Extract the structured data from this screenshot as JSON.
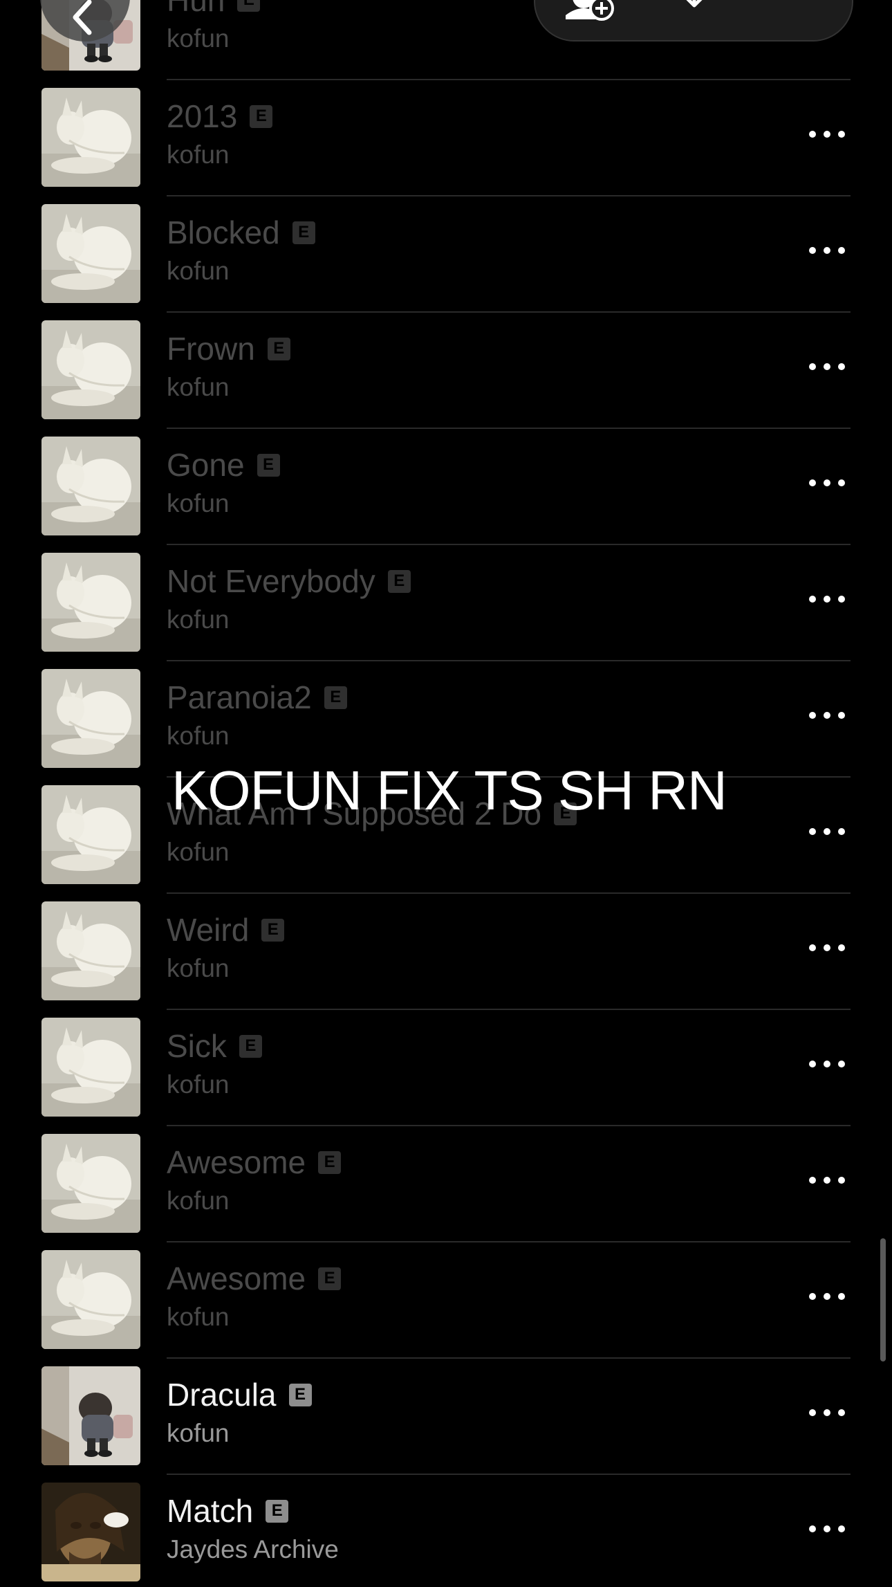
{
  "header": {
    "back_icon": "chevron-left-icon",
    "actions": [
      {
        "name": "add-user-icon"
      },
      {
        "name": "download-icon"
      }
    ]
  },
  "overlay": {
    "caption": "KOFUN FIX TS SH RN"
  },
  "tracks": [
    {
      "title": "Huh",
      "artist": "kofun",
      "explicit": "E",
      "art": "kid",
      "active": false
    },
    {
      "title": "2013",
      "artist": "kofun",
      "explicit": "E",
      "art": "statue",
      "active": false
    },
    {
      "title": "Blocked",
      "artist": "kofun",
      "explicit": "E",
      "art": "statue",
      "active": false
    },
    {
      "title": "Frown",
      "artist": "kofun",
      "explicit": "E",
      "art": "statue",
      "active": false
    },
    {
      "title": "Gone",
      "artist": "kofun",
      "explicit": "E",
      "art": "statue",
      "active": false
    },
    {
      "title": "Not Everybody",
      "artist": "kofun",
      "explicit": "E",
      "art": "statue",
      "active": false
    },
    {
      "title": "Paranoia2",
      "artist": "kofun",
      "explicit": "E",
      "art": "statue",
      "active": false
    },
    {
      "title": "What Am I Supposed 2 Do",
      "artist": "kofun",
      "explicit": "E",
      "art": "statue",
      "active": false
    },
    {
      "title": "Weird",
      "artist": "kofun",
      "explicit": "E",
      "art": "statue",
      "active": false
    },
    {
      "title": "Sick",
      "artist": "kofun",
      "explicit": "E",
      "art": "statue",
      "active": false
    },
    {
      "title": "Awesome",
      "artist": "kofun",
      "explicit": "E",
      "art": "statue",
      "active": false
    },
    {
      "title": "Awesome",
      "artist": "kofun",
      "explicit": "E",
      "art": "statue",
      "active": false
    },
    {
      "title": "Dracula",
      "artist": "kofun",
      "explicit": "E",
      "art": "kid",
      "active": true
    },
    {
      "title": "Match",
      "artist": "Jaydes Archive",
      "explicit": "E",
      "art": "portrait",
      "active": true
    }
  ],
  "colors": {
    "background": "#000000",
    "active_text": "#f2f2f2",
    "dimmed_text": "#4a4a4a"
  }
}
